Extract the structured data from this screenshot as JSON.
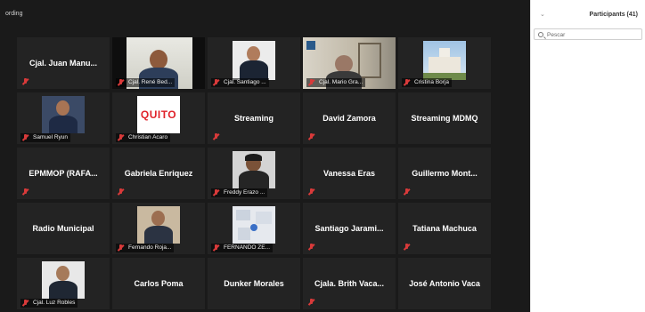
{
  "recording_label": "ording",
  "panel": {
    "title": "Participants (41)",
    "search_placeholder": "Pescar"
  },
  "colors": {
    "gallery_bg": "#1a1a1a",
    "tile_bg": "#232323",
    "muted_icon": "#d83a3a"
  },
  "tiles": [
    {
      "name": "Cjal. Juan Manu...",
      "has_video": false,
      "muted": true
    },
    {
      "label": "Cjal. René Bed...",
      "has_video": true,
      "muted": true
    },
    {
      "label": "Cjal. Santiago ...",
      "has_video": true,
      "muted": true
    },
    {
      "label": "Cjal. Mario Gra...",
      "has_video": true,
      "muted": true
    },
    {
      "label": "Cristina Borja",
      "has_video": true,
      "muted": true
    },
    {
      "label": "Samuel Ryun",
      "has_video": true,
      "muted": true
    },
    {
      "label": "Christian Acaro",
      "has_video": true,
      "muted": true,
      "logo_text": "QUITO"
    },
    {
      "name": "Streaming",
      "has_video": false,
      "muted": true
    },
    {
      "name": "David Zamora",
      "has_video": false,
      "muted": true
    },
    {
      "name": "Streaming MDMQ",
      "has_video": false,
      "muted": false
    },
    {
      "name": "EPMMOP (RAFA...",
      "has_video": false,
      "muted": true
    },
    {
      "name": "Gabriela Enriquez",
      "has_video": false,
      "muted": true
    },
    {
      "label": "Freddy Erazo ...",
      "has_video": true,
      "muted": true
    },
    {
      "name": "Vanessa Eras",
      "has_video": false,
      "muted": true
    },
    {
      "name": "Guillermo Mont...",
      "has_video": false,
      "muted": true
    },
    {
      "name": "Radio Municipal",
      "has_video": false,
      "muted": false
    },
    {
      "label": "Fernando Roja...",
      "has_video": true,
      "muted": true
    },
    {
      "label": "FERNANDO ZE...",
      "has_video": true,
      "muted": true
    },
    {
      "name": "Santiago Jarami...",
      "has_video": false,
      "muted": true
    },
    {
      "name": "Tatiana Machuca",
      "has_video": false,
      "muted": true
    },
    {
      "label": "Cjal. Luz Robles",
      "has_video": true,
      "muted": true
    },
    {
      "name": "Carlos Poma",
      "has_video": false,
      "muted": false
    },
    {
      "name": "Dunker Morales",
      "has_video": false,
      "muted": false
    },
    {
      "name": "Cjala. Brith Vaca...",
      "has_video": false,
      "muted": true
    },
    {
      "name": "José Antonio Vaca",
      "has_video": false,
      "muted": false
    }
  ]
}
